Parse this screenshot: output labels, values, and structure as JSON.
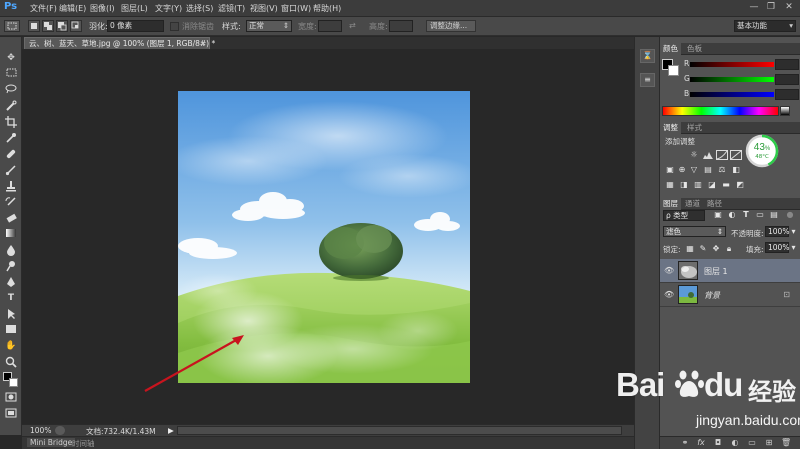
{
  "app": {
    "logo": "Ps"
  },
  "menu": [
    "文件(F)",
    "编辑(E)",
    "图像(I)",
    "图层(L)",
    "文字(Y)",
    "选择(S)",
    "滤镜(T)",
    "视图(V)",
    "窗口(W)",
    "帮助(H)"
  ],
  "window_controls": {
    "minimize": "—",
    "restore": "❐",
    "close": "✕"
  },
  "options": {
    "feather_label": "羽化:",
    "feather_value": "0 像素",
    "antialias_label": "消除锯齿",
    "style_label": "样式:",
    "style_value": "正常",
    "width_label": "宽度:",
    "height_label": "高度:",
    "refine_edge": "调整边缘...",
    "workspace": "基本功能"
  },
  "document": {
    "tab_title": "云、树、蓝天、草地.jpg @ 100% (图层 1, RGB/8#) *",
    "tab_close": "×"
  },
  "status": {
    "zoom": "100%",
    "doc_size": "文档:732.4K/1.43M"
  },
  "bottom_tabs": [
    "Mini Bridge",
    "时间轴"
  ],
  "color_panel": {
    "tabs": [
      "颜色",
      "色板"
    ],
    "channels": [
      "R",
      "G",
      "B"
    ]
  },
  "adjustments_panel": {
    "tabs": [
      "调整",
      "样式"
    ],
    "title": "添加调整"
  },
  "cpu_widget": {
    "percent": "43",
    "percent_unit": "%",
    "temp": "48°C",
    "ring_fraction": 0.43
  },
  "layers_panel": {
    "tabs": [
      "图层",
      "通道",
      "路径"
    ],
    "filter_kind": "ρ 类型",
    "blend_mode": "滤色",
    "opacity_label": "不透明度:",
    "opacity_value": "100%",
    "lock_label": "锁定:",
    "fill_label": "填充:",
    "fill_value": "100%",
    "layers": [
      {
        "name": "图层 1",
        "selected": true
      },
      {
        "name": "背景",
        "locked": true
      }
    ]
  },
  "icons": {
    "eye": "eye-icon",
    "lock": "lock-icon"
  },
  "watermark": {
    "brand": "Bai",
    "brand2": "du",
    "product": "经验",
    "url": "jingyan.baidu.com"
  },
  "colors": {
    "accent_blue": "#4ea7ff",
    "arrow_red": "#c8141e",
    "cpu_green": "#2ecc4a"
  }
}
